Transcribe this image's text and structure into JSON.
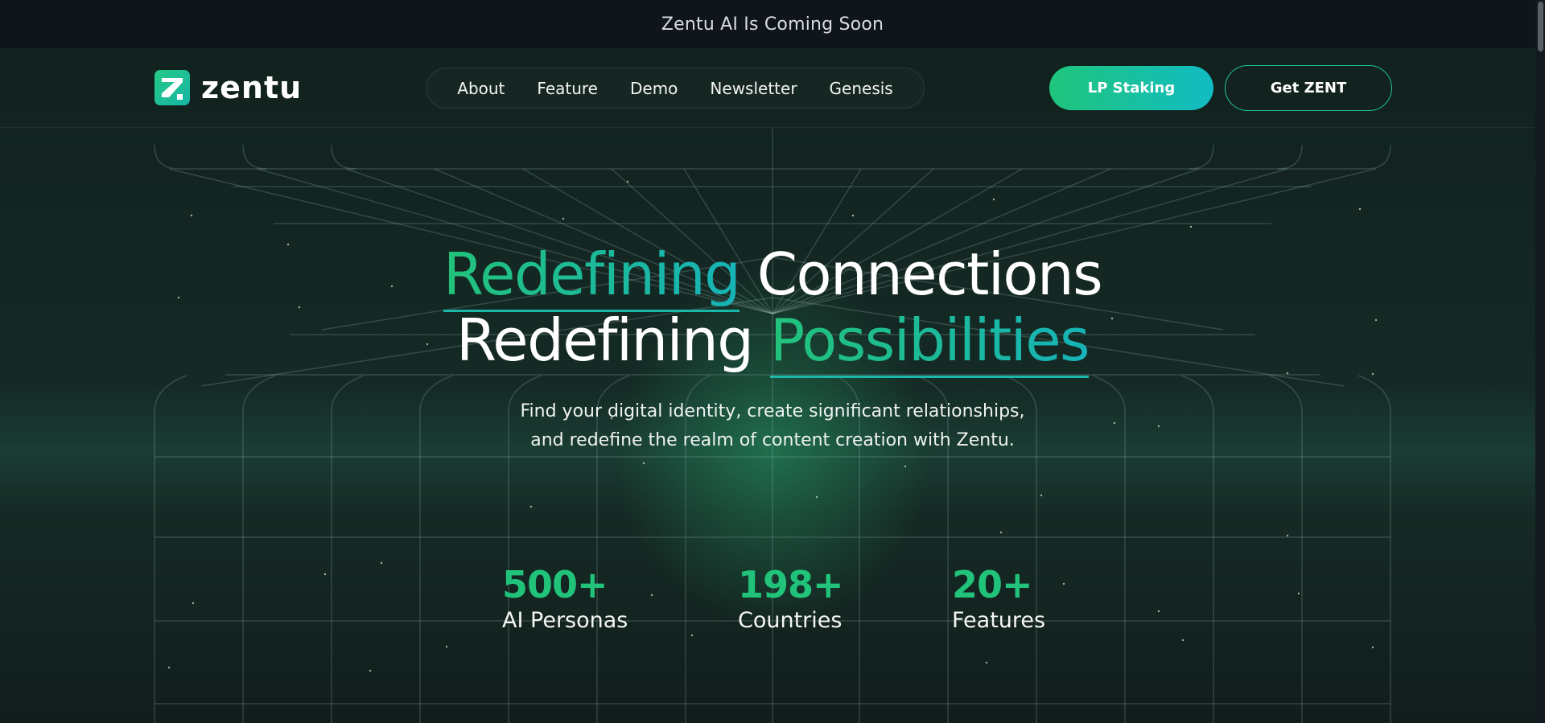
{
  "announcement": {
    "text": "Zentu AI Is Coming Soon"
  },
  "header": {
    "logo_text": "zentu",
    "nav": [
      "About",
      "Feature",
      "Demo",
      "Newsletter",
      "Genesis"
    ],
    "lp_staking_label": "LP Staking",
    "get_zent_label": "Get ZENT"
  },
  "hero": {
    "line1_accent": "Redefining",
    "line1_rest": "Connections",
    "line2_start": "Redefining",
    "line2_accent": "Possibilities",
    "subtitle_line1": "Find your digital identity, create significant relationships,",
    "subtitle_line2": "and redefine the realm of content creation with Zentu."
  },
  "stats": [
    {
      "value": "500+",
      "label": "AI Personas"
    },
    {
      "value": "198+",
      "label": "Countries"
    },
    {
      "value": "20+",
      "label": "Features"
    }
  ],
  "colors": {
    "accent_green": "#21c37a",
    "accent_teal": "#12bcc4",
    "background": "#0f1a18",
    "announcement_bg": "#10151c"
  }
}
